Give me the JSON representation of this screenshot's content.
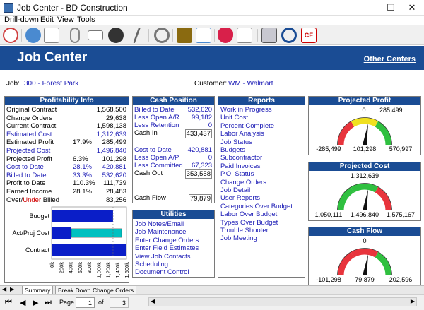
{
  "window": {
    "title": "Job Center - BD Construction"
  },
  "menu": [
    "Drill-down",
    "Edit",
    "View",
    "Tools"
  ],
  "header": {
    "title": "Job Center",
    "other_centers": "Other Centers"
  },
  "job": {
    "job_label": "Job:",
    "job_value": "300 - Forest Park",
    "customer_label": "Customer:",
    "customer_value": "WM - Walmart"
  },
  "profitability": {
    "title": "Profitability Info",
    "rows": [
      {
        "label": "Original Contract",
        "pct": "",
        "value": "1,568,500",
        "link": false
      },
      {
        "label": "Change Orders",
        "pct": "",
        "value": "29,638",
        "link": false
      },
      {
        "label": "Current Contract",
        "pct": "",
        "value": "1,598,138",
        "link": false
      },
      {
        "label": "Estimated Cost",
        "pct": "",
        "value": "1,312,639",
        "link": true
      },
      {
        "label": "Estimated Profit",
        "pct": "17.9%",
        "value": "285,499",
        "link": false
      },
      {
        "label": "Projected Cost",
        "pct": "",
        "value": "1,496,840",
        "link": true
      },
      {
        "label": "Projected Profit",
        "pct": "6.3%",
        "value": "101,298",
        "link": false
      },
      {
        "label": "Cost to Date",
        "pct": "28.1%",
        "value": "420,881",
        "link": true
      },
      {
        "label": "Billed to Date",
        "pct": "33.3%",
        "value": "532,620",
        "link": true
      },
      {
        "label": "Profit to Date",
        "pct": "110.3%",
        "value": "111,739",
        "link": false
      },
      {
        "label": "Earned Income",
        "pct": "28.1%",
        "value": "28,483",
        "link": false
      }
    ],
    "over_label": "Over/",
    "under_label": "Under",
    "billed_label": " Billed",
    "over_under_value": "83,256"
  },
  "chart_data": {
    "type": "bar",
    "categories": [
      "Budget",
      "Act/Proj Cost",
      "Contract"
    ],
    "series": [
      {
        "values": [
          1312639,
          420881,
          1598138
        ]
      },
      {
        "values": [
          0,
          1496840,
          0
        ]
      }
    ],
    "xticks": [
      "0k",
      "200k",
      "400k",
      "600k",
      "800k",
      "1,000k",
      "1,200k",
      "1,400k",
      "1,600k"
    ],
    "xlim": [
      0,
      1600000
    ],
    "colors": {
      "primary": "#0a1ec8",
      "secondary": "#00c0c0"
    }
  },
  "cash_position": {
    "title": "Cash Position",
    "rows": [
      {
        "label": "Billed to Date",
        "value": "532,620",
        "link": true,
        "boxed": false
      },
      {
        "label": "Less Open A/R",
        "value": "99,182",
        "link": true,
        "boxed": false
      },
      {
        "label": "Less Retention",
        "value": "0",
        "link": true,
        "boxed": false
      },
      {
        "label": "Cash In",
        "value": "433,437",
        "link": false,
        "boxed": true
      },
      {
        "label": "Cost to Date",
        "value": "420,881",
        "link": true,
        "boxed": false
      },
      {
        "label": "Less Open A/P",
        "value": "0",
        "link": true,
        "boxed": false
      },
      {
        "label": "Less Committed",
        "value": "67,323",
        "link": true,
        "boxed": false
      },
      {
        "label": "Cash Out",
        "value": "353,558",
        "link": false,
        "boxed": true
      },
      {
        "label": "Cash Flow",
        "value": "79,879",
        "link": false,
        "boxed": true
      }
    ]
  },
  "utilities": {
    "title": "Utilities",
    "items": [
      "Job Notes/Email",
      "Job Maintenance",
      "Enter Change Orders",
      "Enter Field Estimates",
      "View Job Contacts",
      "Scheduling",
      "Document Control"
    ]
  },
  "reports": {
    "title": "Reports",
    "items": [
      "Work in Progress",
      "Unit Cost",
      "Percent Complete",
      "Labor Analysis",
      "Job Status",
      "Budgets",
      "Subcontractor",
      "Paid Invoices",
      "P.O. Status",
      "Change Orders",
      "Job Detail",
      "User Reports",
      "Categories Over Budget",
      "Labor Over Budget",
      "Types Over Budget",
      "Trouble Shooter",
      "Job Meeting"
    ]
  },
  "gauges": [
    {
      "title": "Projected Profit",
      "top": "0",
      "top_right": "285,499",
      "left": "-285,499",
      "center": "101,298",
      "right": "570,997",
      "colors": [
        "#e8343c",
        "#f0e020",
        "#30c040"
      ]
    },
    {
      "title": "Projected Cost",
      "top": "1,312,639",
      "top_right": "",
      "left": "1,050,111",
      "center": "1,496,840",
      "right": "1,575,167",
      "colors": [
        "#30c040",
        "#30c040",
        "#e8343c"
      ]
    },
    {
      "title": "Cash Flow",
      "top": "0",
      "top_right": "",
      "left": "-101,298",
      "center": "79,879",
      "right": "202,596",
      "colors": [
        "#e8343c",
        "#e8343c",
        "#30c040"
      ]
    }
  ],
  "tabs": [
    "Summary",
    "Break Down",
    "Change Orders"
  ],
  "nav": {
    "page_label": "Page",
    "page_value": "1",
    "of_label": "of",
    "of_value": "3"
  }
}
